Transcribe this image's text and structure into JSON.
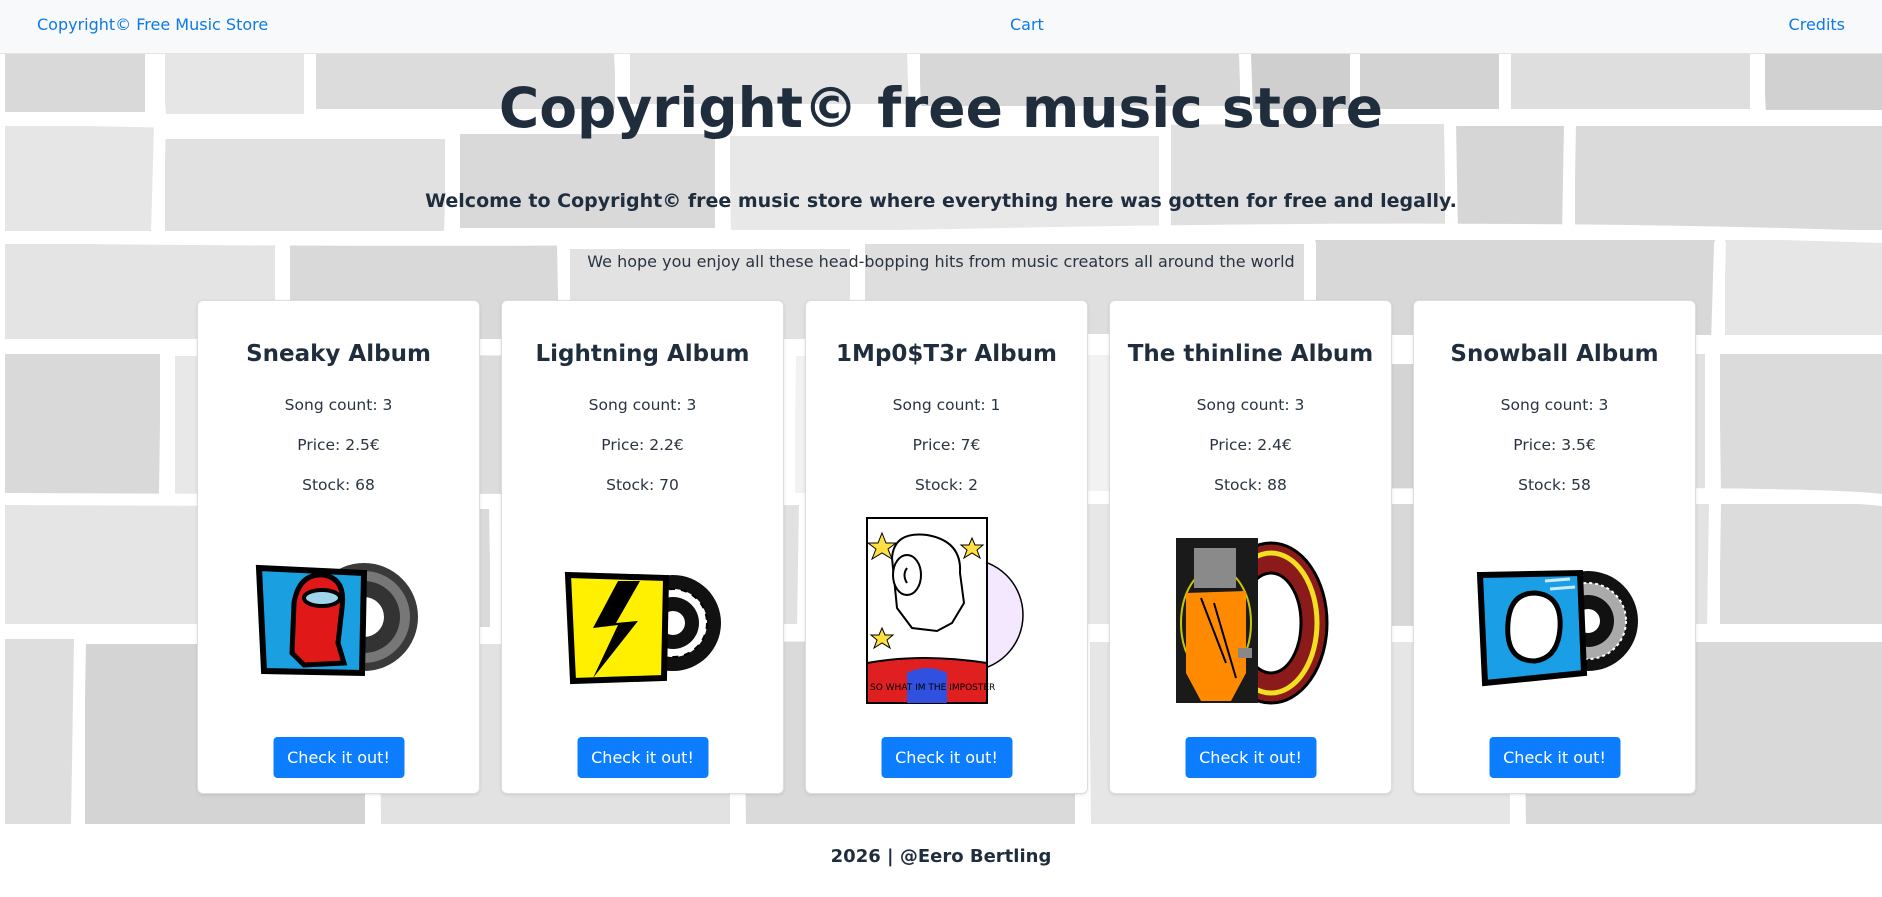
{
  "navbar": {
    "brand": "Copyright© Free Music Store",
    "cart": "Cart",
    "credits": "Credits"
  },
  "hero": {
    "title": "Copyright© free music store",
    "lead": "Welcome to Copyright© free music store where everything here was gotten for free and legally.",
    "subtitle": "We hope you enjoy all these head-bopping hits from music creators all around the world"
  },
  "albums": [
    {
      "title": "Sneaky Album",
      "songs": "Song count: 3",
      "price": "Price: 2.5€",
      "stock": "Stock: 68",
      "button": "Check it out!",
      "art": "sneaky-mug"
    },
    {
      "title": "Lightning Album",
      "songs": "Song count: 3",
      "price": "Price: 2.2€",
      "stock": "Stock: 70",
      "button": "Check it out!",
      "art": "lightning-mug"
    },
    {
      "title": "1Mp0$T3r Album",
      "songs": "Song count: 1",
      "price": "Price: 7€",
      "stock": "Stock: 2",
      "button": "Check it out!",
      "art": "impostor-cover",
      "art_text": "SO WHAT IM THE IMPOSTER"
    },
    {
      "title": "The thinline Album",
      "songs": "Song count: 3",
      "price": "Price: 2.4€",
      "stock": "Stock: 88",
      "button": "Check it out!",
      "art": "thinline-cover"
    },
    {
      "title": "Snowball Album",
      "songs": "Song count: 3",
      "price": "Price: 3.5€",
      "stock": "Stock: 58",
      "button": "Check it out!",
      "art": "snowball-mug"
    }
  ],
  "footer": {
    "text": "2026 | @Eero Bertling"
  },
  "colors": {
    "link": "#0d7ae6",
    "button": "#0d7dff",
    "heading": "#1f2d3d"
  }
}
